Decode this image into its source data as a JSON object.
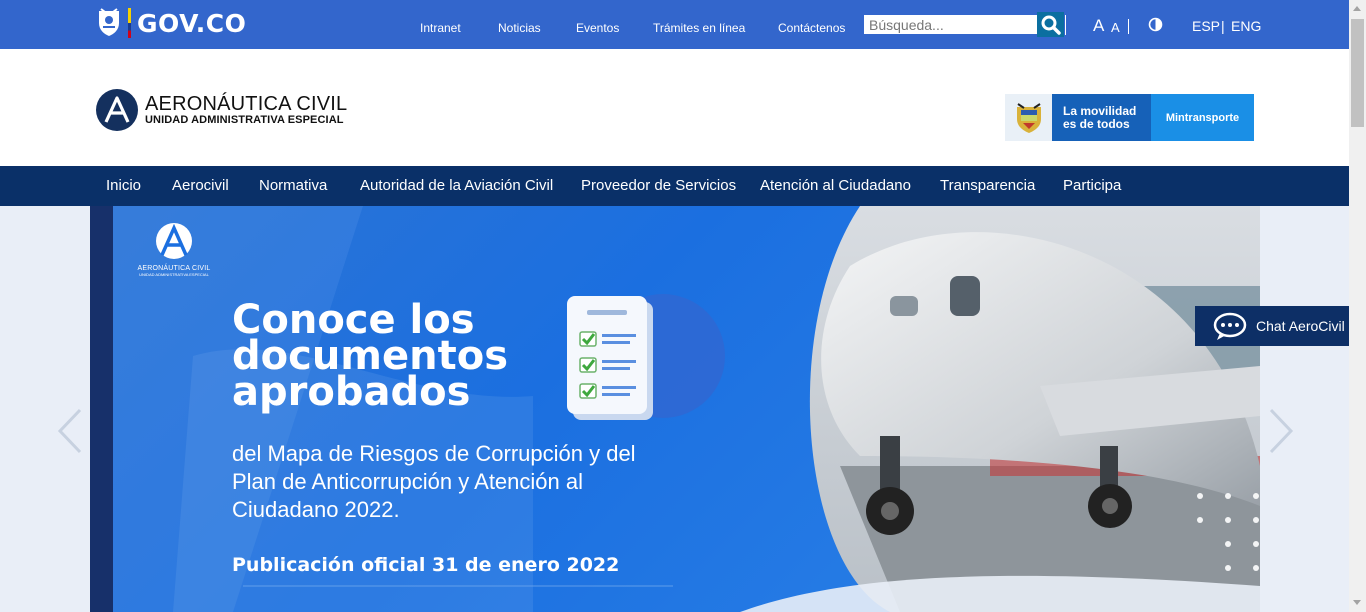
{
  "govbar": {
    "logo_text": "GOV.CO",
    "nav": [
      "Intranet",
      "Noticias",
      "Eventos",
      "Trámites en línea",
      "Contáctenos"
    ],
    "search": {
      "placeholder": "Búsqueda..."
    },
    "font_large": "A",
    "font_small": "A",
    "lang_esp": "ESP",
    "lang_sep": "|",
    "lang_eng": "ENG",
    "colors": {
      "bar": "#3366cc"
    }
  },
  "header": {
    "logo_title": "AERONÁUTICA CIVIL",
    "logo_subtitle": "UNIDAD ADMINISTRATIVA ESPECIAL",
    "mintransporte": {
      "line1": "La movilidad",
      "line2": "es de todos",
      "label": "Mintransporte"
    }
  },
  "mainnav": {
    "items": [
      "Inicio",
      "Aerocivil",
      "Normativa",
      "Autoridad de la Aviación Civil",
      "Proveedor de Servicios",
      "Atención al Ciudadano",
      "Transparencia",
      "Participa"
    ],
    "color": "#0a3068"
  },
  "hero": {
    "mini_logo_line1": "AERONÁUTICA CIVIL",
    "mini_logo_line2": "UNIDAD ADMINISTRATIVA ESPECIAL",
    "title_line1": "Conoce los",
    "title_line2": "documentos",
    "title_line3": "aprobados",
    "subtitle_line1": "del Mapa de Riesgos de Corrupción y del",
    "subtitle_line2": "Plan de Anticorrupción y Atención al",
    "subtitle_line3": "Ciudadano 2022.",
    "publication": "Publicación oficial 31 de enero 2022"
  },
  "chat": {
    "label": "Chat AeroCivil"
  },
  "icons": {
    "search": "search-icon",
    "contrast": "contrast-icon",
    "prev": "chevron-left-icon",
    "next": "chevron-right-icon",
    "chat": "chat-bubble-icon"
  }
}
